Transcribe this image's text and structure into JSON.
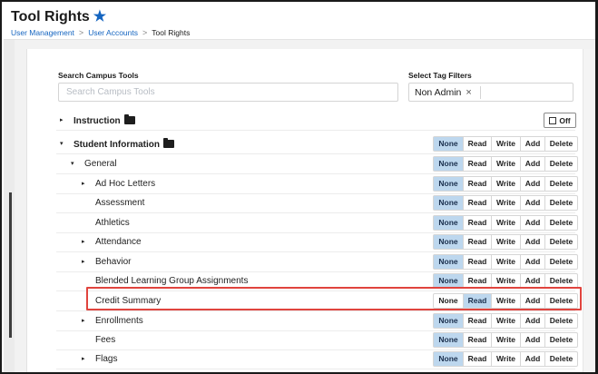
{
  "header": {
    "title": "Tool Rights",
    "breadcrumb": [
      "User Management",
      "User Accounts",
      "Tool Rights"
    ]
  },
  "search": {
    "label": "Search Campus Tools",
    "placeholder": "Search Campus Tools",
    "value": ""
  },
  "tag_filters": {
    "label": "Select Tag Filters",
    "selected": "Non Admin",
    "remove_symbol": "×"
  },
  "rights_labels": [
    "None",
    "Read",
    "Write",
    "Add",
    "Delete"
  ],
  "off_button_label": "Off",
  "tree": [
    {
      "label": "Instruction",
      "expander": "▸",
      "bold": true,
      "folder": true,
      "control": "off"
    },
    {
      "label": "Student Information",
      "expander": "▾",
      "bold": true,
      "folder": true,
      "active": "None"
    },
    {
      "label": "General",
      "expander": "▾",
      "active": "None"
    },
    {
      "label": "Ad Hoc Letters",
      "expander": "▸",
      "active": "None"
    },
    {
      "label": "Assessment",
      "expander": "",
      "active": "None"
    },
    {
      "label": "Athletics",
      "expander": "",
      "active": "None"
    },
    {
      "label": "Attendance",
      "expander": "▸",
      "active": "None"
    },
    {
      "label": "Behavior",
      "expander": "▸",
      "active": "None"
    },
    {
      "label": "Blended Learning Group Assignments",
      "expander": "",
      "active": "None"
    },
    {
      "label": "Credit Summary",
      "expander": "",
      "active": "Read",
      "highlighted": true
    },
    {
      "label": "Enrollments",
      "expander": "▸",
      "active": "None"
    },
    {
      "label": "Fees",
      "expander": "",
      "active": "None"
    },
    {
      "label": "Flags",
      "expander": "▸",
      "active": "None"
    }
  ],
  "colors": {
    "accent": "#1565c0",
    "active_right": "#bdd7ee",
    "highlight_border": "#e0443e"
  }
}
